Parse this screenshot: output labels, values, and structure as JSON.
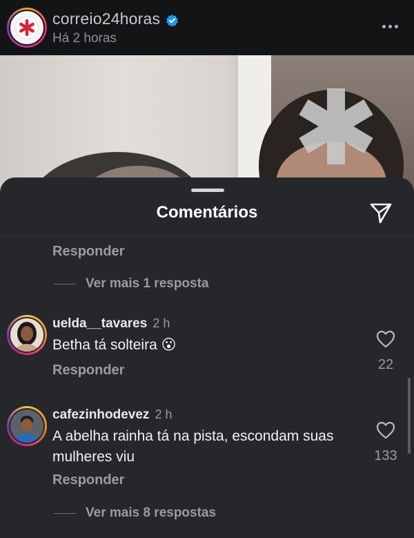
{
  "story": {
    "username": "correio24horas",
    "time": "Há 2 horas",
    "colors": {
      "brand_red": "#d9233a",
      "verified_blue": "#1d9bf0"
    }
  },
  "sheet": {
    "title": "Comentários"
  },
  "top_thread": {
    "reply_label": "Responder",
    "view_more": "Ver mais 1 resposta"
  },
  "comments": [
    {
      "username": "uelda__tavares",
      "time": "2 h",
      "text": "Betha tá solteira",
      "emoji": "😮",
      "likes": "22",
      "reply_label": "Responder"
    },
    {
      "username": "cafezinhodevez",
      "time": "2 h",
      "text": "A abelha rainha tá na pista, escondam suas mulheres viu",
      "likes": "133",
      "reply_label": "Responder",
      "view_more": "Ver mais 8 respostas"
    }
  ],
  "icons": {
    "verified": "verified-badge-icon",
    "more": "more-options-icon",
    "share": "send-icon",
    "like": "heart-icon"
  }
}
